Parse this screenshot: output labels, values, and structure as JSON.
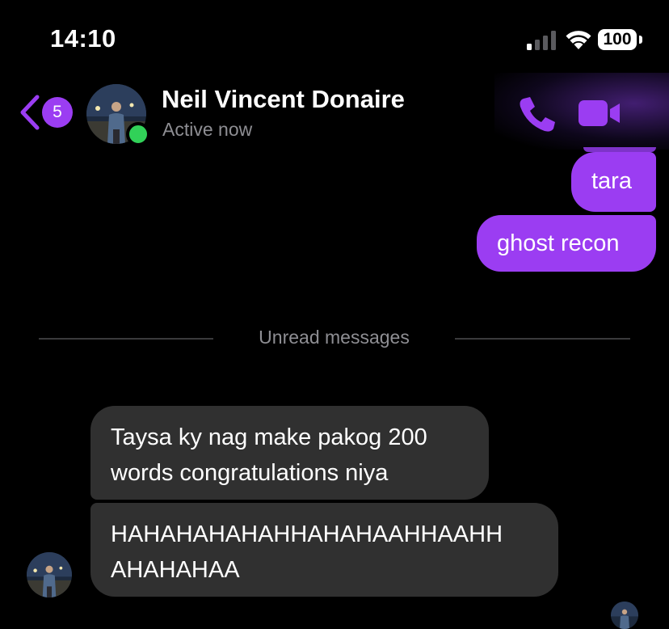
{
  "status_bar": {
    "time": "14:10",
    "battery": "100"
  },
  "header": {
    "back_badge_count": "5",
    "contact_name": "Neil Vincent Donaire",
    "contact_status": "Active now",
    "presence_color": "#31d158",
    "back_icon": "chevron-left-icon",
    "call_icon": "phone-icon",
    "video_icon": "video-camera-icon"
  },
  "messages": {
    "outgoing": [
      {
        "text": "tara"
      },
      {
        "text": "ghost recon"
      }
    ],
    "unread_divider": "Unread messages",
    "incoming": [
      {
        "lines": [
          "Taysa ky nag make pakog 200",
          "words congratulations niya"
        ]
      },
      {
        "lines": [
          "HAHAHAHAHAHHAHAHAAHHAAHH",
          "AHAHAHAA"
        ]
      }
    ]
  },
  "theme": {
    "accent": "#9b3df2",
    "incoming_bubble": "#303030",
    "background": "#000000",
    "secondary_text": "#8e8e93"
  }
}
